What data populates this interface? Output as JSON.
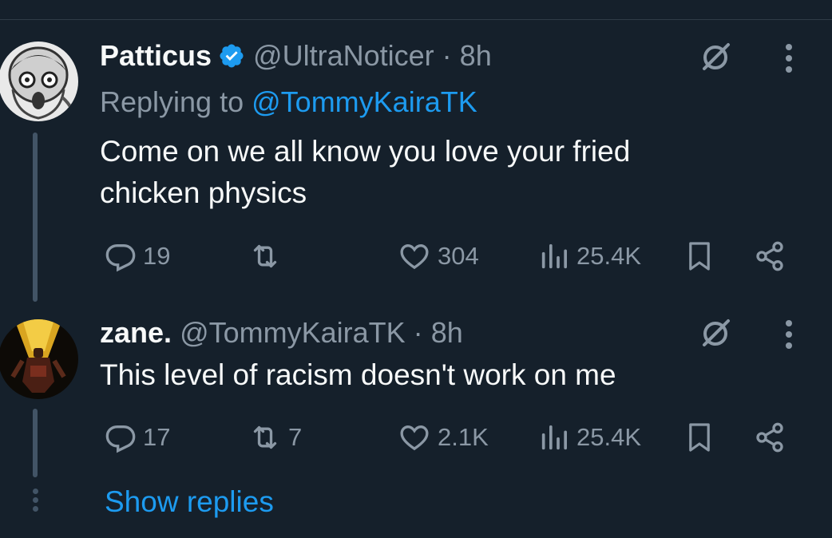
{
  "tweets": [
    {
      "name": "Patticus",
      "verified": true,
      "handle": "@UltraNoticer",
      "separator": "·",
      "time": "8h",
      "replying_prefix": "Replying to",
      "replying_to": "@TommyKairaTK",
      "text_line1": "Come on we all know you love your fried",
      "text_line2": "chicken physics",
      "replies": "19",
      "retweets": "",
      "likes": "304",
      "views": "25.4K"
    },
    {
      "name": "zane.",
      "verified": false,
      "handle": "@TommyKairaTK",
      "separator": "·",
      "time": "8h",
      "text_line1": "This level of racism doesn't work on me",
      "replies": "17",
      "retweets": "7",
      "likes": "2.1K",
      "views": "25.4K"
    }
  ],
  "show_replies_label": "Show replies",
  "colors": {
    "background": "#15202b",
    "accent": "#1d9bf0",
    "muted": "#8b98a5",
    "text": "#f7f9f9"
  }
}
